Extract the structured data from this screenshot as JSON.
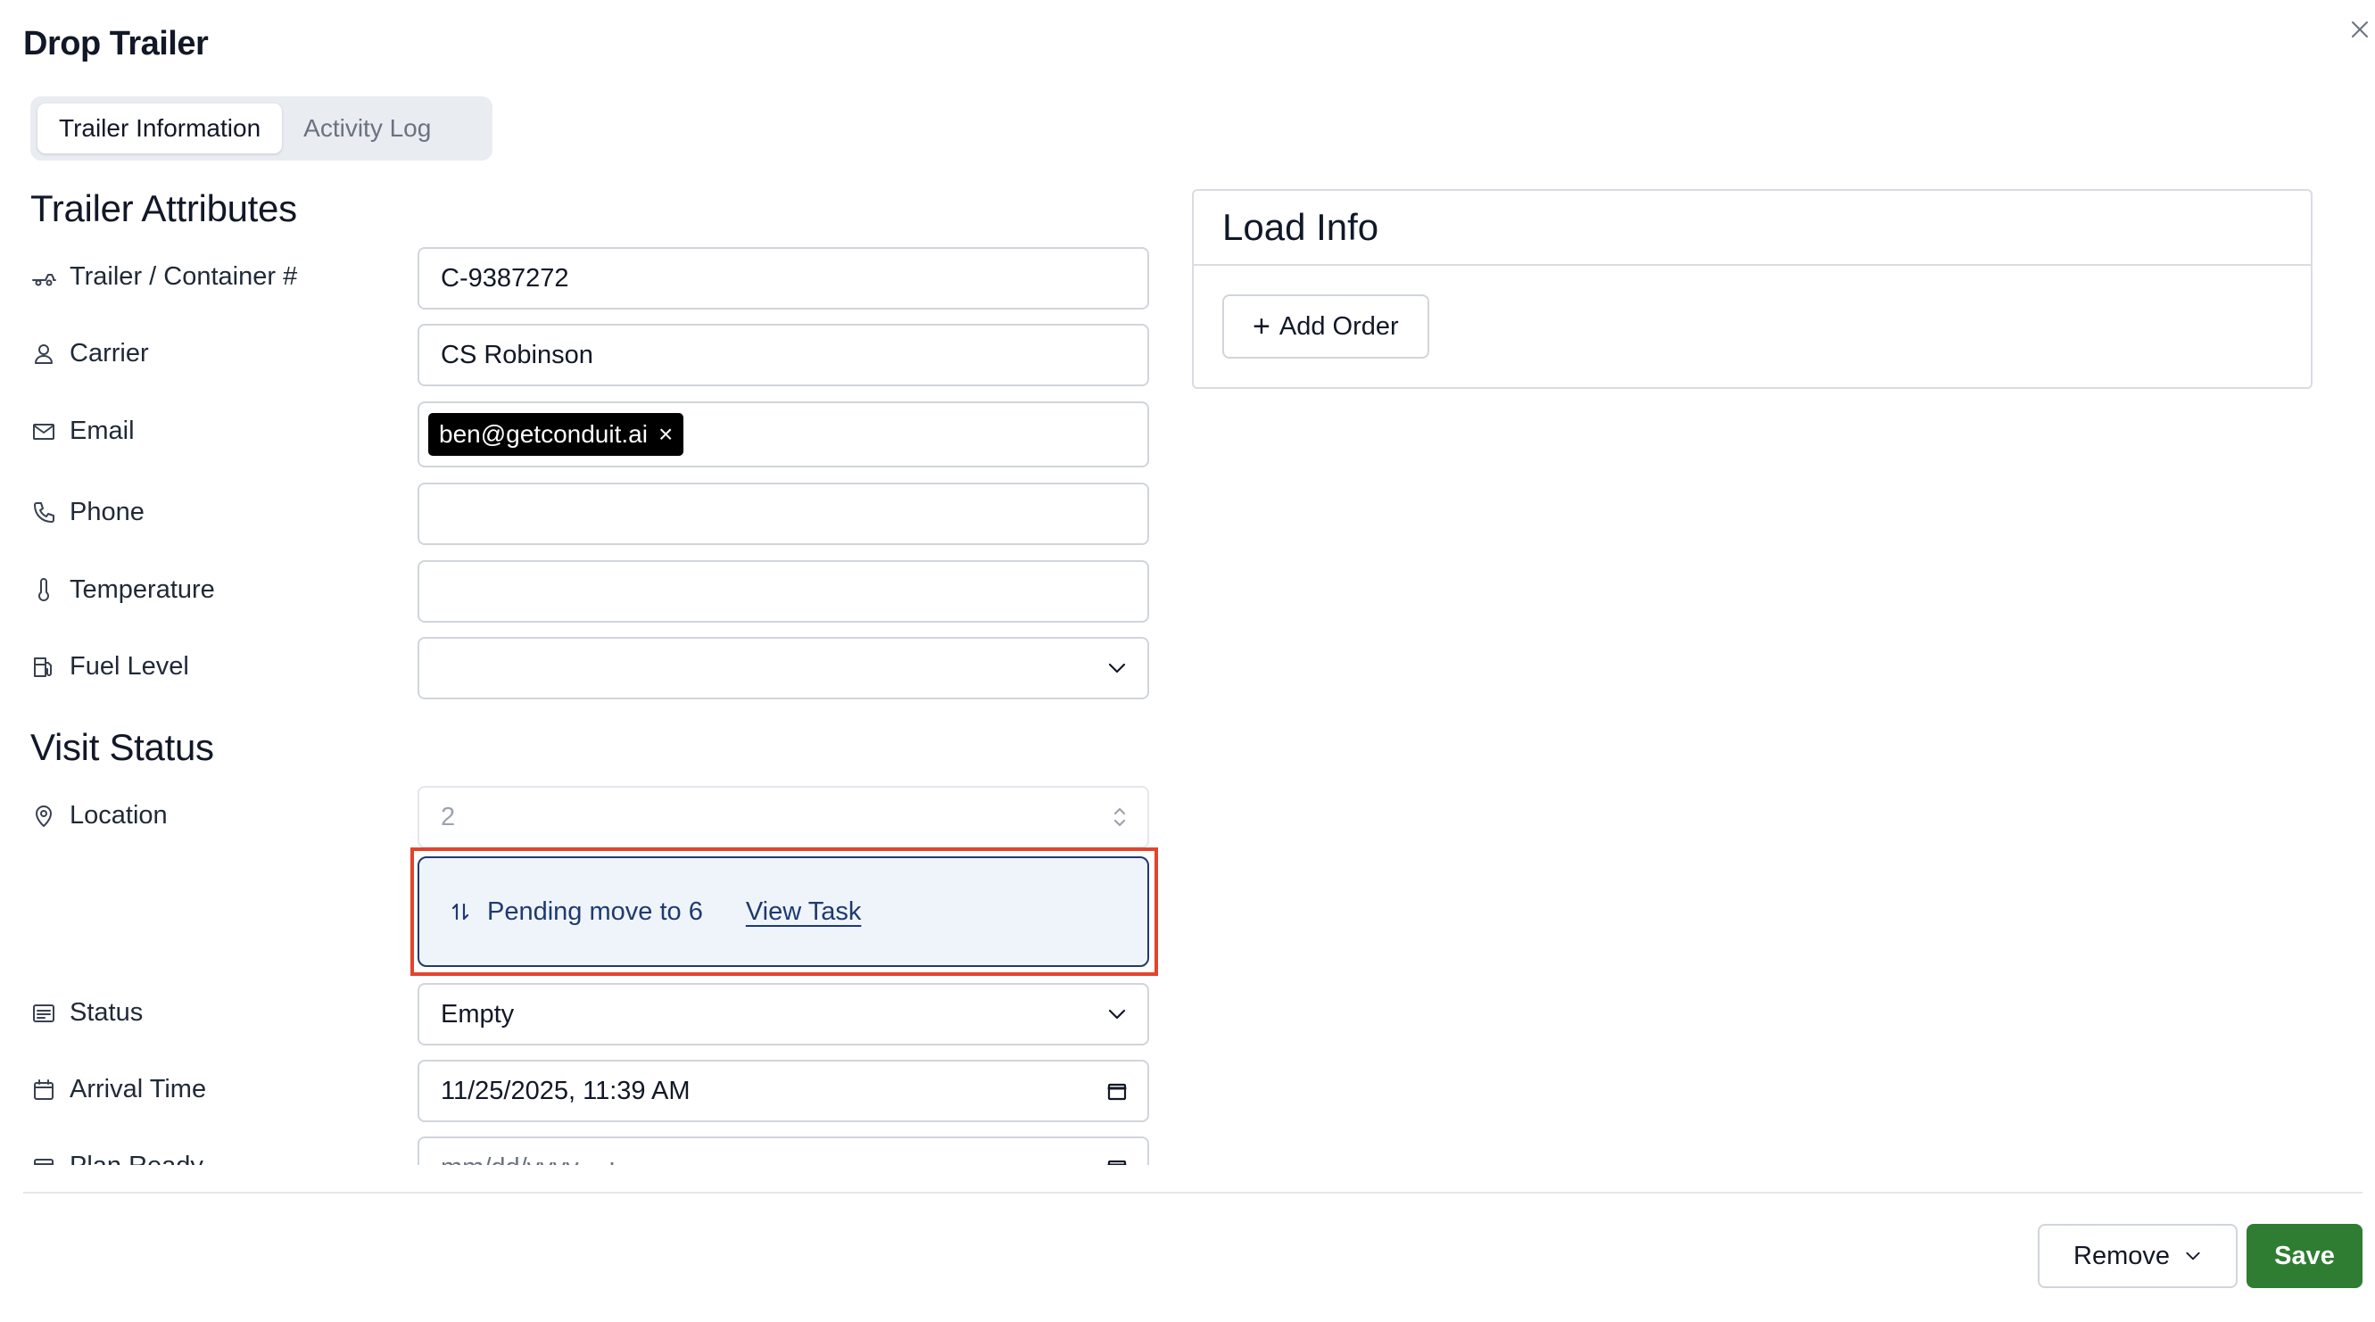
{
  "dialog": {
    "title": "Drop Trailer"
  },
  "tabs": [
    {
      "label": "Trailer Information",
      "active": true
    },
    {
      "label": "Activity Log",
      "active": false
    }
  ],
  "trailer_attributes": {
    "section_title": "Trailer Attributes",
    "trailer_container": {
      "label": "Trailer / Container #",
      "value": "C-9387272",
      "icon": "truck-icon"
    },
    "carrier": {
      "label": "Carrier",
      "value": "CS Robinson",
      "icon": "person-icon"
    },
    "email": {
      "label": "Email",
      "chip": "ben@getconduit.ai",
      "chip_remove": "×",
      "icon": "envelope-icon"
    },
    "phone": {
      "label": "Phone",
      "value": "",
      "icon": "phone-icon"
    },
    "temperature": {
      "label": "Temperature",
      "value": "",
      "icon": "thermometer-icon"
    },
    "fuel_level": {
      "label": "Fuel Level",
      "value": "",
      "icon": "fuel-pump-icon"
    }
  },
  "visit_status": {
    "section_title": "Visit Status",
    "location": {
      "label": "Location",
      "value": "2",
      "icon": "map-pin-icon"
    },
    "pending_move": {
      "text": "Pending move to 6",
      "link": "View Task",
      "icon": "swap-vertical-icon"
    },
    "status": {
      "label": "Status",
      "value": "Empty",
      "icon": "list-icon"
    },
    "arrival_time": {
      "label": "Arrival Time",
      "value": "11/25/2025, 11:39  AM",
      "icon": "calendar-icon"
    },
    "plan_ready": {
      "label": "Plan Ready",
      "value": "mm/dd/yyyy, --:-- --",
      "icon": "calendar-icon"
    }
  },
  "load_info": {
    "title": "Load Info",
    "add_order_label": "Add Order"
  },
  "footer": {
    "remove_label": "Remove",
    "save_label": "Save"
  },
  "colors": {
    "save_button": "#2f7d32",
    "highlight_border": "#e3432d",
    "pending_text": "#1e3a70",
    "pending_bg": "#eff4fb"
  }
}
